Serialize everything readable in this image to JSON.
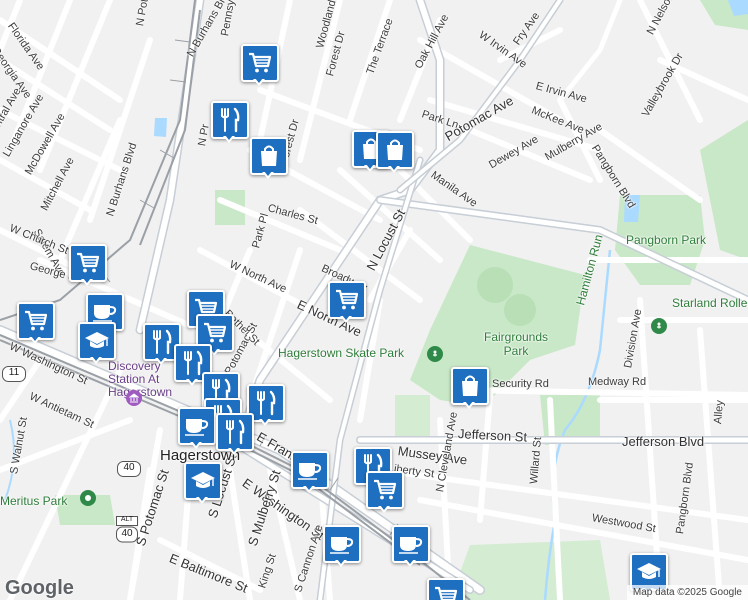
{
  "map": {
    "brand": "Google",
    "attribution": "Map data ©2025 Google",
    "colors": {
      "marker": "#1e6fc0",
      "park": "#c9e8c7",
      "road": "#ffffff",
      "major_road": "#c7ced6",
      "water": "#aadaff",
      "rail": "#9aa0a6"
    }
  },
  "labels": {
    "florida": "Florida Ave",
    "georgia": "Georgia Ave",
    "central": "Central Ave",
    "linganore": "Linganore Ave",
    "mcdowell": "McDowell Ave",
    "mitchell": "Mitchell Ave",
    "salem": "Salem Ave",
    "wchurch": "W Church St",
    "george": "George St",
    "wwashington": "W Washington St",
    "wantietam": "W Antietam St",
    "swalnut": "S Walnut St",
    "npotomac_top": "N Potomac St",
    "nburhans": "N Burhans Blvd",
    "nburhans2": "N Burhans Blvd",
    "pennsylvania": "Pennsylvania Ave",
    "woodland": "Woodland Way",
    "forest_top": "Forest Dr",
    "terrace": "The Terrace",
    "oakhill": "Oak Hill Ave",
    "wirvin": "W Irvin Ave",
    "fry": "Fry Ave",
    "eirvin": "E Irvin Ave",
    "nelson": "N Nelson Ave",
    "valleybrook": "Valleybrook Dr",
    "parkln": "Park Ln",
    "potomacave": "Potomac Ave",
    "mckee": "McKee Ave",
    "dewey": "Dewey Ave",
    "mulberryave": "Mulberry Ave",
    "manila": "Manila Ave",
    "pangbornblvd": "Pangborn Blvd",
    "forest_mid": "Forest Dr",
    "npr": "N Pr",
    "charles": "Charles St",
    "parkpl": "Park Pl",
    "wnorth": "W North Ave",
    "broadway": "Broadway",
    "nlocust": "N Locust St",
    "enorth": "E North Ave",
    "bethel": "Bethel St",
    "potomac_mid": "Potomac St",
    "efrank": "E Frank",
    "ewashington": "E Washington St",
    "spotomac": "S Potomac St",
    "slocust": "S Locust St",
    "smulberry": "S Mulberry St",
    "ebaltimore": "E Baltimore St",
    "king": "King St",
    "cannon": "S Cannon Ave",
    "mussey": "Mussey Ave",
    "liberty": "Liberty St",
    "jefferson": "Jefferson St",
    "jeffersonblvd": "Jefferson Blvd",
    "security": "Security Rd",
    "medway": "Medway Rd",
    "ncleveland": "N Cleveland Ave",
    "willard": "Willard St",
    "westwood": "Westwood St",
    "pangbornblvd2": "Pangborn Blvd",
    "division": "Division Ave",
    "alley": "Alley",
    "hamiltonrun": "Hamilton Run",
    "pangbornpark": "Pangborn Park",
    "starland": "Starland Roller Rink",
    "fairgrounds": "Fairgrounds Park",
    "skatepark": "Hagerstown Skate Park",
    "discovery": "Discovery Station At Hagerstown",
    "hagerstown": "Hagerstown",
    "meritus": "Meritus Park"
  },
  "route_shields": {
    "us11": "11",
    "us40": "40",
    "alt40": "40",
    "alt_label": "ALT"
  },
  "markers": [
    {
      "name": "shopping-cart-marker-1",
      "icon": "shopping-cart-icon"
    },
    {
      "name": "restaurant-marker-1",
      "icon": "fork-knife-icon"
    },
    {
      "name": "shopping-bag-marker-1",
      "icon": "shopping-bag-icon"
    },
    {
      "name": "shopping-bag-marker-2",
      "icon": "shopping-bag-icon"
    },
    {
      "name": "shopping-bag-marker-3",
      "icon": "shopping-bag-icon"
    },
    {
      "name": "shopping-cart-marker-2",
      "icon": "shopping-cart-icon"
    },
    {
      "name": "shopping-cart-marker-3",
      "icon": "shopping-cart-icon"
    },
    {
      "name": "cafe-marker-1",
      "icon": "coffee-cup-icon"
    },
    {
      "name": "school-marker-1",
      "icon": "graduation-cap-icon"
    },
    {
      "name": "shopping-cart-marker-4",
      "icon": "shopping-cart-icon"
    },
    {
      "name": "restaurant-marker-2",
      "icon": "fork-knife-icon"
    },
    {
      "name": "shopping-cart-marker-5",
      "icon": "shopping-cart-icon"
    },
    {
      "name": "restaurant-marker-3",
      "icon": "fork-knife-icon"
    },
    {
      "name": "restaurant-marker-4",
      "icon": "fork-knife-icon"
    },
    {
      "name": "restaurant-marker-5",
      "icon": "fork-knife-icon"
    },
    {
      "name": "restaurant-marker-6",
      "icon": "fork-knife-icon"
    },
    {
      "name": "cafe-marker-2",
      "icon": "coffee-cup-icon"
    },
    {
      "name": "restaurant-marker-7",
      "icon": "fork-knife-icon"
    },
    {
      "name": "shopping-cart-marker-6",
      "icon": "shopping-cart-icon"
    },
    {
      "name": "shopping-bag-marker-4",
      "icon": "shopping-bag-icon"
    },
    {
      "name": "cafe-marker-3",
      "icon": "coffee-cup-icon"
    },
    {
      "name": "restaurant-marker-8",
      "icon": "fork-knife-icon"
    },
    {
      "name": "shopping-cart-marker-7",
      "icon": "shopping-cart-icon"
    },
    {
      "name": "school-marker-2",
      "icon": "graduation-cap-icon"
    },
    {
      "name": "cafe-marker-4",
      "icon": "coffee-cup-icon"
    },
    {
      "name": "cafe-marker-5",
      "icon": "coffee-cup-icon"
    },
    {
      "name": "school-marker-3",
      "icon": "graduation-cap-icon"
    },
    {
      "name": "shopping-cart-marker-8",
      "icon": "shopping-cart-icon"
    }
  ]
}
